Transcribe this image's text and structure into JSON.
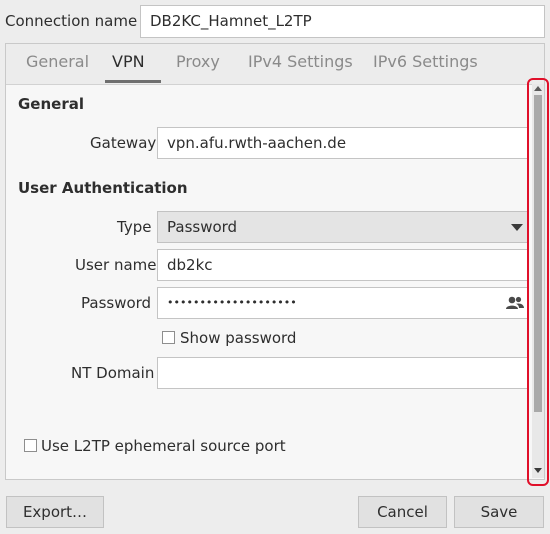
{
  "connection": {
    "label": "Connection name",
    "value": "DB2KC_Hamnet_L2TP"
  },
  "tabs": [
    {
      "label": "General"
    },
    {
      "label": "VPN"
    },
    {
      "label": "Proxy"
    },
    {
      "label": "IPv4 Settings"
    },
    {
      "label": "IPv6 Settings"
    }
  ],
  "general": {
    "heading": "General",
    "gateway_label": "Gateway",
    "gateway_value": "vpn.afu.rwth-aachen.de"
  },
  "auth": {
    "heading": "User Authentication",
    "type_label": "Type",
    "type_value": "Password",
    "username_label": "User name",
    "username_value": "db2kc",
    "password_label": "Password",
    "password_value": "••••••••••••••••••••",
    "show_password_label": "Show password",
    "nt_domain_label": "NT Domain",
    "nt_domain_value": ""
  },
  "options": {
    "ephemeral_label": "Use L2TP ephemeral source port"
  },
  "buttons": {
    "export": "Export…",
    "cancel": "Cancel",
    "save": "Save"
  },
  "colors": {
    "highlight": "#e0102a",
    "window_bg": "#ededed"
  },
  "icons": {
    "password_icon": "users-icon"
  }
}
